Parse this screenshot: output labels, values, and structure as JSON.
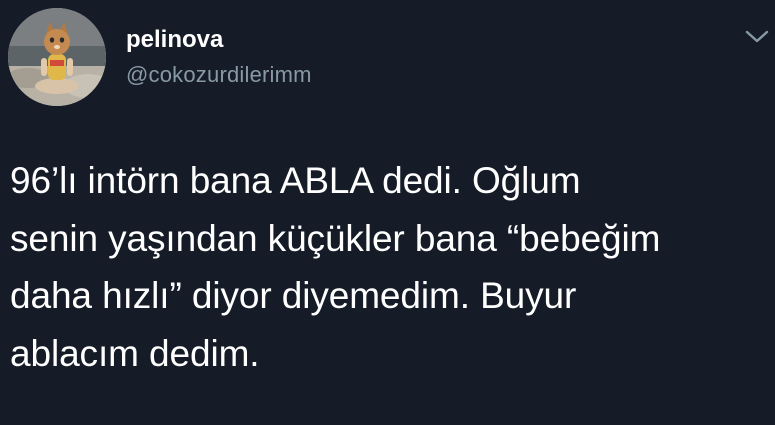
{
  "author": {
    "display_name": "pelinova",
    "handle": "@cokozurdilerimm",
    "avatar_icon": "profile-photo"
  },
  "menu": {
    "icon": "chevron-down-icon"
  },
  "tweet": {
    "text": "96’lı intörn bana ABLA dedi. Oğlum\nsenin yaşından küçükler bana “bebeğim\ndaha hızlı” diyor diyemedim. Buyur\nablacım dedim."
  },
  "colors": {
    "background": "#151c28",
    "text": "#ffffff",
    "secondary_text": "#8899a6"
  }
}
